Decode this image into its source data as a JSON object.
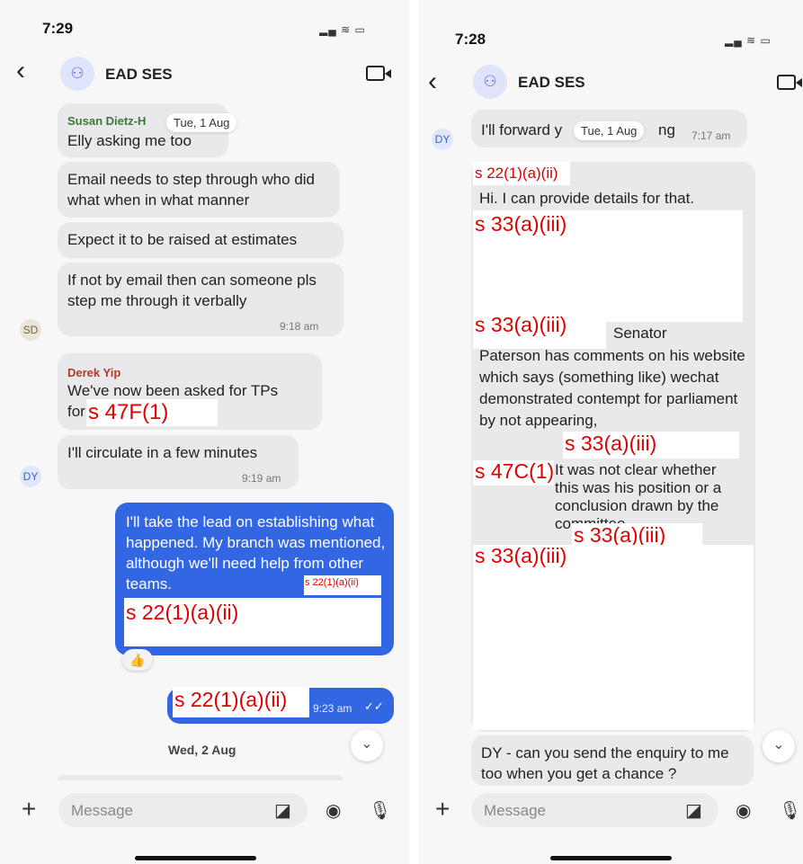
{
  "left": {
    "status_time": "7:29",
    "chat_title": "EAD SES",
    "date_pill": "Tue, 1 Aug",
    "m1_sender": "Susan Dietz-H",
    "m1_text": "Elly asking me too",
    "m2_text": "Email needs to step through who did what when in what manner",
    "m3_text": "Expect it to be raised at estimates",
    "m4_text": "If not by email then can someone pls step me through it verbally",
    "m4_time": "9:18 am",
    "avatar_sd": "SD",
    "m5_sender": "Derek Yip",
    "m5_text": "We've now been asked for TPs for",
    "m5_redaction": "s 47F(1)",
    "m6_text": "I'll circulate in a few minutes",
    "m6_time": "9:19 am",
    "avatar_dy": "DY",
    "m7_text": "I'll take the lead on establishing what happened. My branch was mentioned, although we'll need help from other teams.",
    "m7_redaction_small": "s 22(1)(a)(ii)",
    "m7_redaction_big": "s 22(1)(a)(ii)",
    "reaction": "👍",
    "m8_redaction": "s 22(1)(a)(ii)",
    "m8_time": "9:23 am",
    "date_sep": "Wed, 2 Aug",
    "input_placeholder": "Message"
  },
  "right": {
    "status_time": "7:28",
    "chat_title": "EAD SES",
    "avatar_dy": "DY",
    "m1_text_a": "I'll forward y",
    "date_pill": "Tue, 1 Aug",
    "m1_text_b": "ng",
    "m1_time": "7:17 am",
    "r1": "s 22(1)(a)(ii)",
    "text1": "Hi. I can provide details for that.",
    "r2": "s 33(a)(iii)",
    "r3": "s 33(a)(iii)",
    "text2": "Senator",
    "text3": "Paterson has comments on his website which says (something like) wechat demonstrated contempt for parliament by not appearing,",
    "r4": "s 33(a)(iii)",
    "r5": "s 47C(1)",
    "text4": "It was not clear whether this was his position or a conclusion drawn by the committee.",
    "r6": "s 33(a)(iii)",
    "r7": "s 33(a)(iii)",
    "m_last": "DY - can you send the enquiry to me too when you get a chance ?",
    "input_placeholder": "Message"
  }
}
